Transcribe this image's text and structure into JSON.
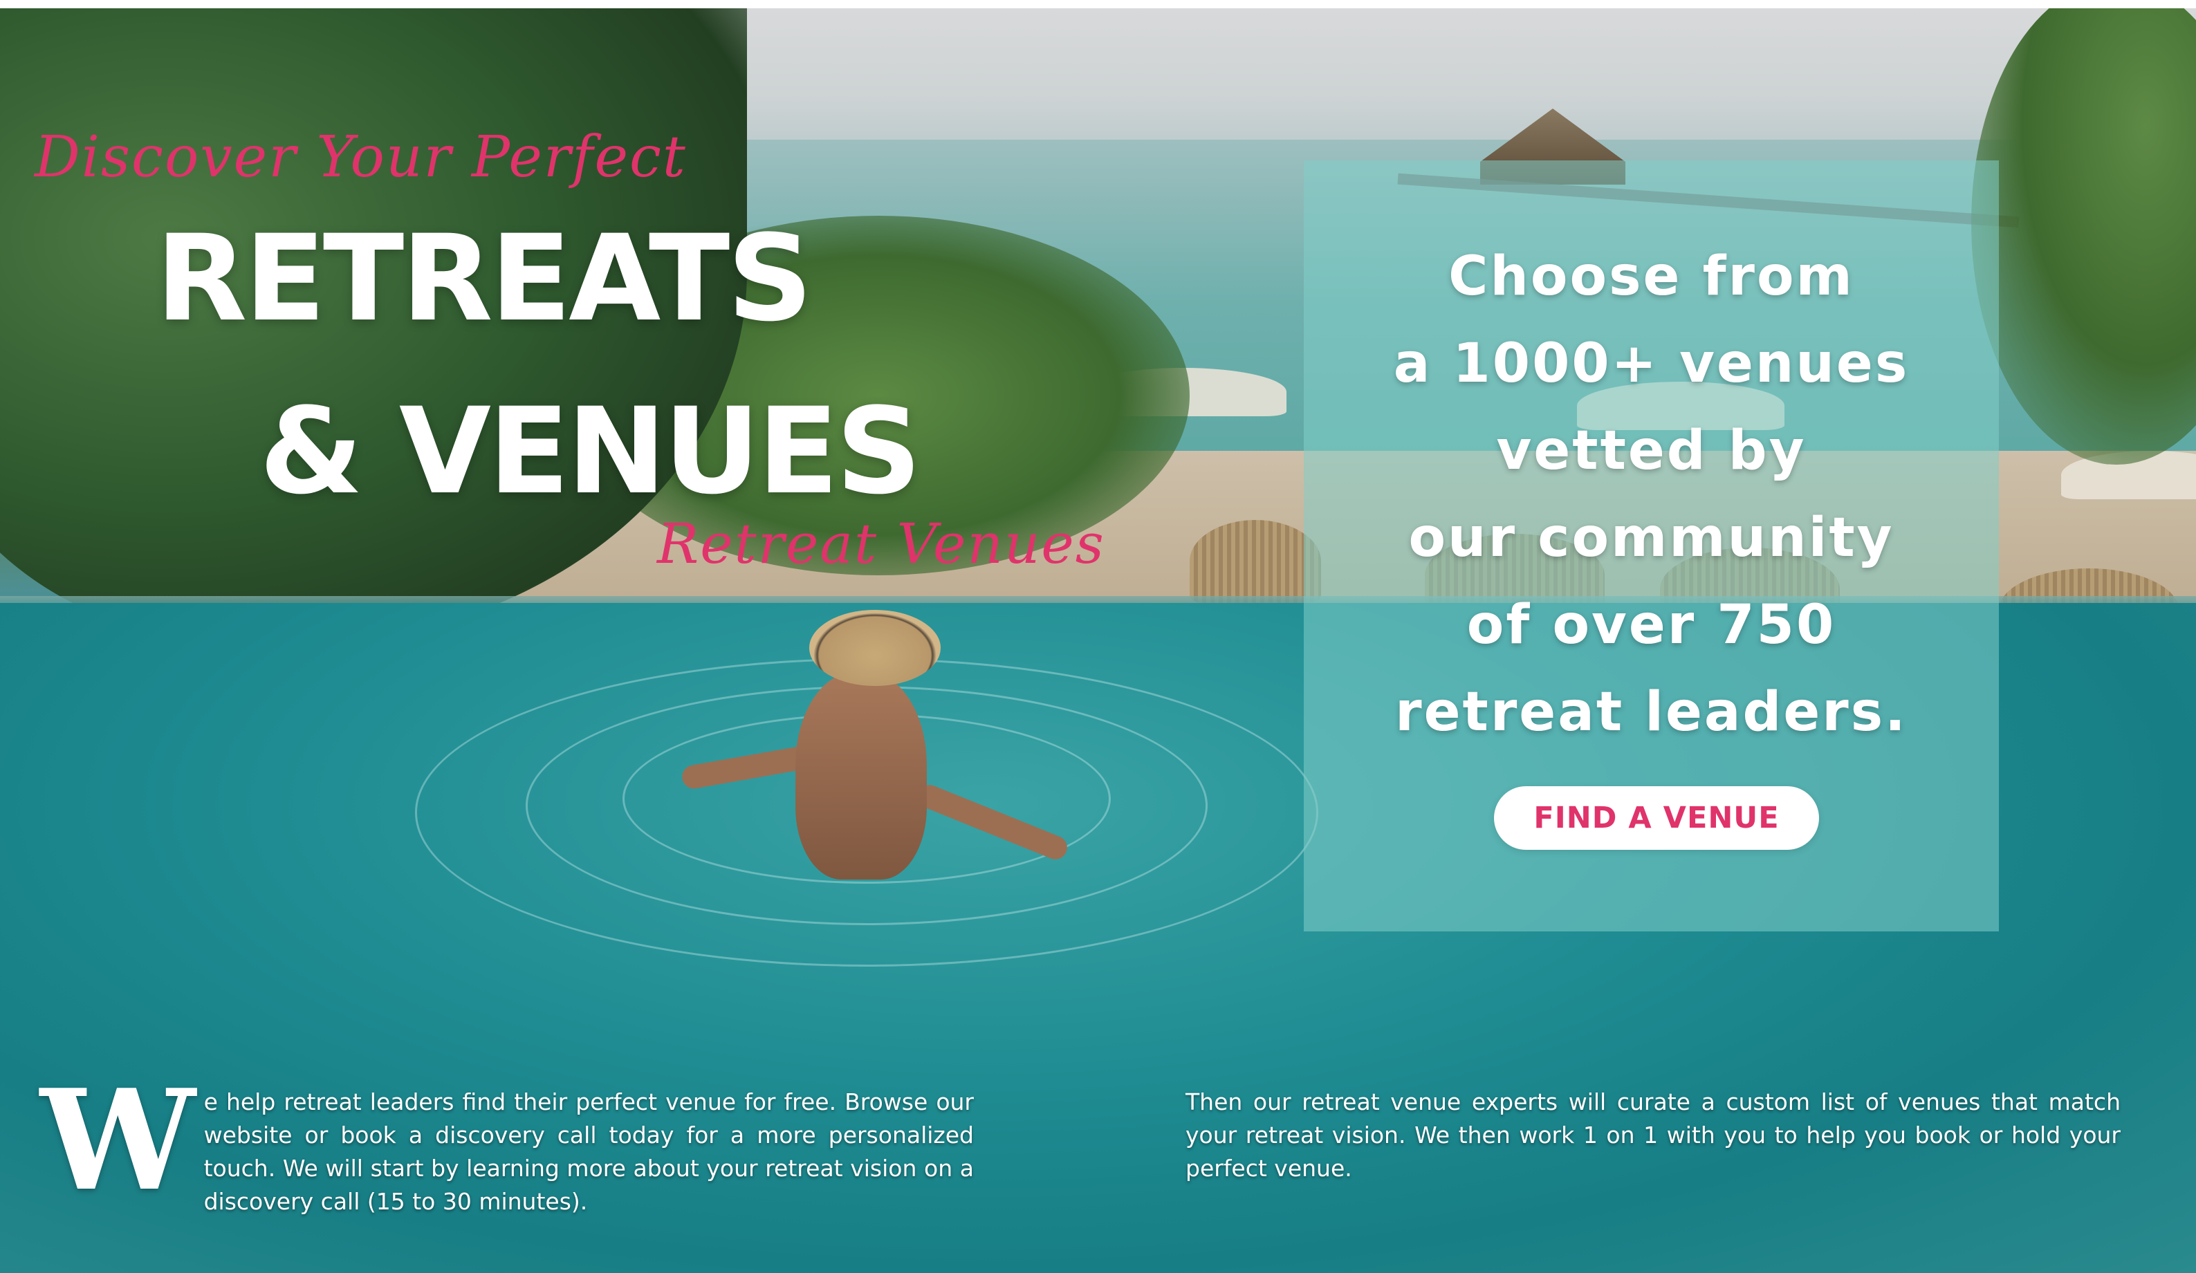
{
  "hero": {
    "script_top": "Discover Your Perfect",
    "title_line_1": "RETREATS",
    "title_line_2": "& VENUES",
    "script_bottom": "Retreat Venues"
  },
  "panel": {
    "lines": [
      "Choose from",
      "a 1000+ venues",
      "vetted by",
      "our community",
      "of over 750",
      "retreat leaders."
    ],
    "cta_label": "FIND A VENUE"
  },
  "intro": {
    "dropcap": "W",
    "left_text": "e help retreat leaders find their perfect venue for free. Browse our website or book a discovery call today for a more personalized touch. We will start by learning more about your retreat vision on a discovery call (15 to 30 minutes).",
    "right_text": "Then our retreat venue experts will curate a custom list of venues that match your retreat vision. We then work 1 on 1 with you to help you book or hold your perfect venue."
  },
  "colors": {
    "accent_pink": "#e0336b",
    "panel_teal": "#82cdc8",
    "text_white": "#ffffff"
  }
}
